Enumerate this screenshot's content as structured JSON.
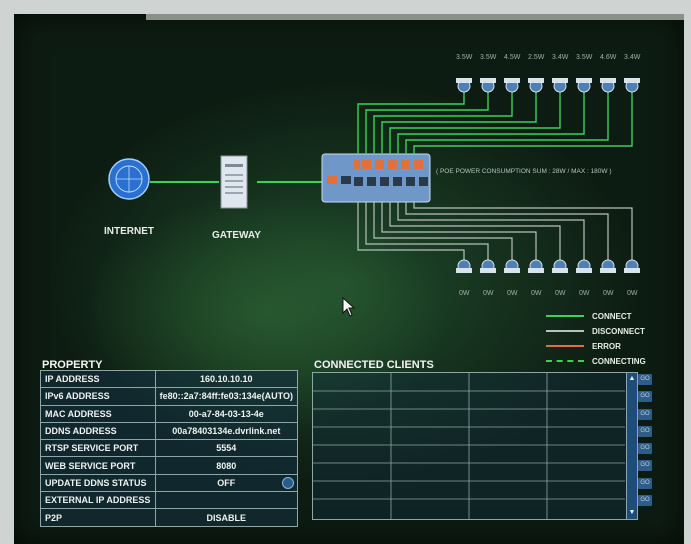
{
  "network": {
    "internet_label": "INTERNET",
    "gateway_label": "GATEWAY",
    "switch_caption": "( POE POWER CONSUMPTION SUM : 28W / MAX : 180W )",
    "top_camera_labels": [
      "3.5W",
      "3.5W",
      "4.5W",
      "2.5W",
      "3.4W",
      "3.5W",
      "4.6W",
      "3.4W"
    ],
    "bottom_camera_labels": [
      "0W",
      "0W",
      "0W",
      "0W",
      "0W",
      "0W",
      "0W",
      "0W"
    ]
  },
  "legend": {
    "items": [
      {
        "label": "CONNECT",
        "color": "#3fcf5a",
        "style": "solid"
      },
      {
        "label": "DISCONNECT",
        "color": "#b8c0bc",
        "style": "solid"
      },
      {
        "label": "ERROR",
        "color": "#e2703a",
        "style": "solid"
      },
      {
        "label": "CONNECTING",
        "color": "#3fcf5a",
        "style": "dashed"
      }
    ]
  },
  "property": {
    "title": "PROPERTY",
    "rows": [
      {
        "key": "IP ADDRESS",
        "value": "160.10.10.10"
      },
      {
        "key": "IPv6 ADDRESS",
        "value": "fe80::2a7:84ff:fe03:134e(AUTO)"
      },
      {
        "key": "MAC ADDRESS",
        "value": "00-a7-84-03-13-4e"
      },
      {
        "key": "DDNS ADDRESS",
        "value": "00a78403134e.dvrlink.net"
      },
      {
        "key": "RTSP SERVICE PORT",
        "value": "5554"
      },
      {
        "key": "WEB SERVICE PORT",
        "value": "8080"
      },
      {
        "key": "UPDATE DDNS STATUS",
        "value": "OFF"
      },
      {
        "key": "EXTERNAL IP ADDRESS",
        "value": ""
      },
      {
        "key": "P2P",
        "value": "DISABLE"
      }
    ]
  },
  "clients": {
    "title": "CONNECTED CLIENTS",
    "go_label": "GO"
  },
  "colors": {
    "connect": "#3fcf5a",
    "disconnect": "#b8c0bc",
    "error": "#e2703a",
    "panel_border": "#8fa6a6"
  }
}
